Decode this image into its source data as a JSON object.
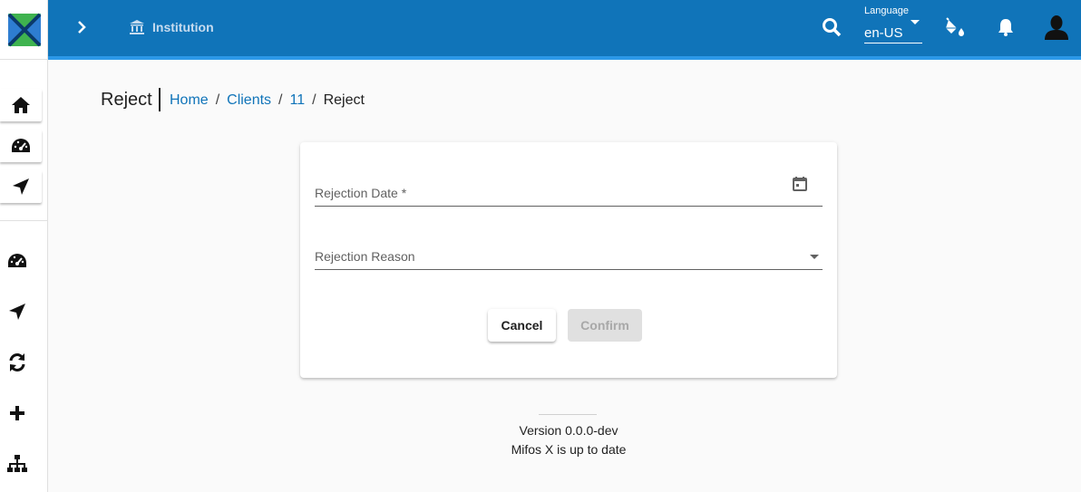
{
  "app": {
    "logo": "mifos-x-logo",
    "colors": {
      "primary": "#1074b9",
      "accent_strip": "#2b98e8",
      "link": "#1074b9"
    }
  },
  "sidebar": {
    "top_buttons": [
      {
        "icon": "home-icon"
      },
      {
        "icon": "dashboard-icon"
      },
      {
        "icon": "navigation-icon"
      }
    ],
    "icons": [
      {
        "icon": "dashboard-icon"
      },
      {
        "icon": "navigation-icon"
      },
      {
        "icon": "sync-icon"
      },
      {
        "icon": "plus-icon"
      },
      {
        "icon": "sitemap-icon"
      }
    ]
  },
  "toolbar": {
    "institution_label": "Institution",
    "language_label": "Language",
    "language_value": "en-US"
  },
  "breadcrumb": {
    "page_title": "Reject",
    "items": [
      "Home",
      "Clients",
      "11"
    ],
    "separator": "/",
    "current": "Reject"
  },
  "form": {
    "rejection_date_label": "Rejection Date *",
    "rejection_reason_label": "Rejection Reason",
    "cancel_label": "Cancel",
    "confirm_label": "Confirm"
  },
  "footer": {
    "version": "Version 0.0.0-dev",
    "status": "Mifos X is up to date"
  }
}
